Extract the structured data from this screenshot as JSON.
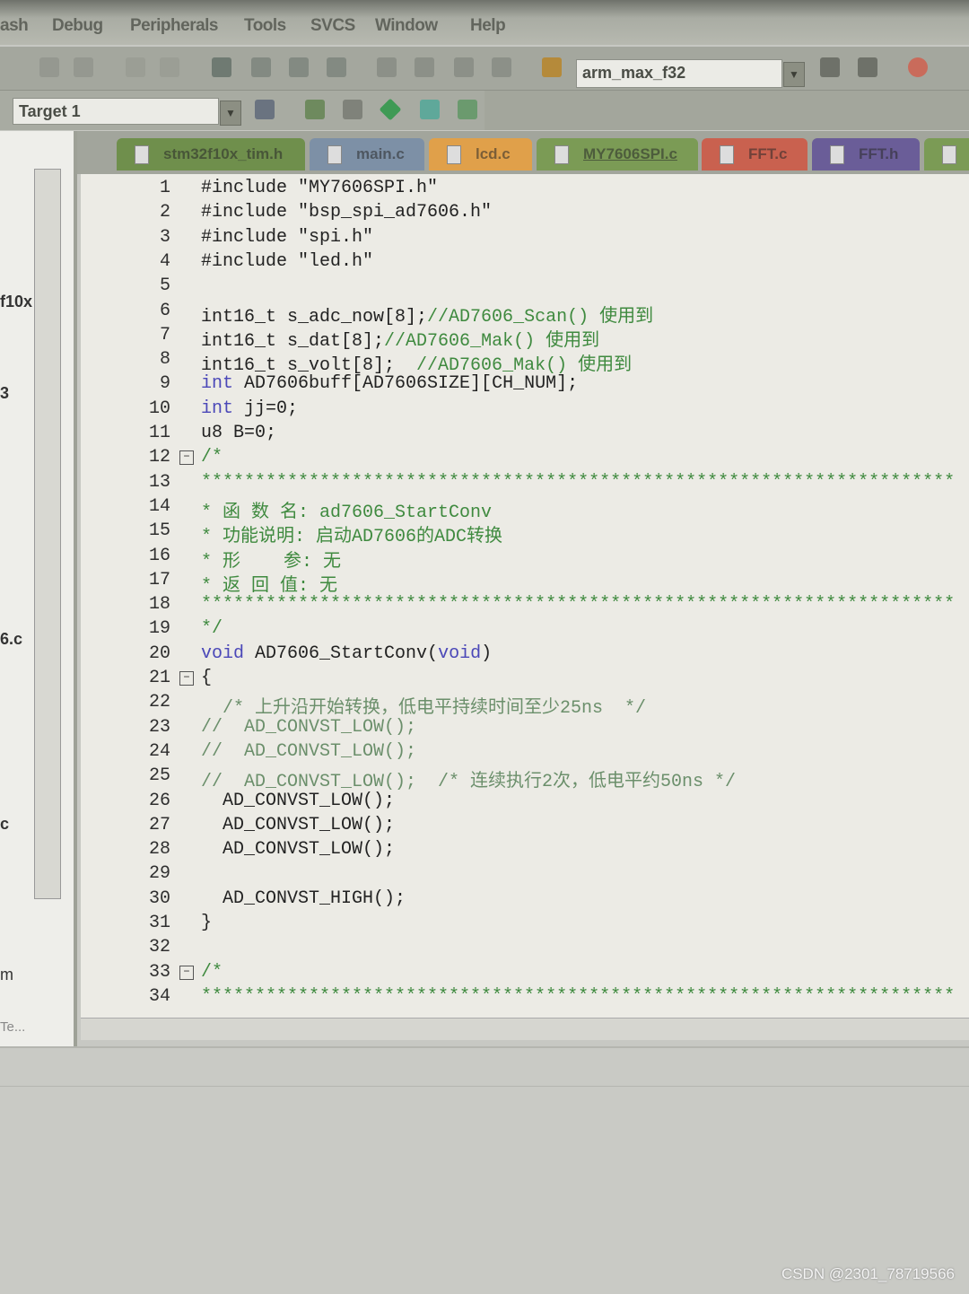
{
  "menu": [
    "ash",
    "Debug",
    "Peripherals",
    "Tools",
    "SVCS",
    "Window",
    "Help"
  ],
  "toolbar": {
    "find_combo_value": "arm_max_f32",
    "target_combo_value": "Target 1"
  },
  "tabs": [
    {
      "label": "stm32f10x_tim.h",
      "color": "#6f8f4c"
    },
    {
      "label": "main.c",
      "color": "#7d90a6"
    },
    {
      "label": "lcd.c",
      "color": "#e0a04a"
    },
    {
      "label": "MY7606SPI.c",
      "color": "#7b9b55",
      "active": true
    },
    {
      "label": "FFT.c",
      "color": "#c9614f"
    },
    {
      "label": "FFT.h",
      "color": "#6a5d98"
    },
    {
      "label": "",
      "color": "#7b9b55"
    }
  ],
  "left_panel": {
    "fragments": [
      "f10x",
      "3",
      "6.c",
      "c",
      "m",
      "Te..."
    ]
  },
  "code_lines": [
    {
      "n": "1",
      "t": [
        [
          "n",
          "#include \"MY7606SPI.h\""
        ]
      ]
    },
    {
      "n": "2",
      "t": [
        [
          "n",
          "#include \"bsp_spi_ad7606.h\""
        ]
      ]
    },
    {
      "n": "3",
      "t": [
        [
          "n",
          "#include \"spi.h\""
        ]
      ]
    },
    {
      "n": "4",
      "t": [
        [
          "n",
          "#include \"led.h\""
        ]
      ]
    },
    {
      "n": "5",
      "t": []
    },
    {
      "n": "6",
      "t": [
        [
          "n",
          "int16_t s_adc_now[8];"
        ],
        [
          "c",
          "//AD7606_Scan() 使用到"
        ]
      ]
    },
    {
      "n": "7",
      "t": [
        [
          "n",
          "int16_t s_dat[8];"
        ],
        [
          "c",
          "//AD7606_Mak() 使用到"
        ]
      ]
    },
    {
      "n": "8",
      "t": [
        [
          "n",
          "int16_t s_volt[8];  "
        ],
        [
          "c",
          "//AD7606_Mak() 使用到"
        ]
      ]
    },
    {
      "n": "9",
      "t": [
        [
          "k",
          "int"
        ],
        [
          "n",
          " AD7606buff[AD7606SIZE][CH_NUM];"
        ]
      ]
    },
    {
      "n": "10",
      "t": [
        [
          "k",
          "int"
        ],
        [
          "n",
          " jj=0;"
        ]
      ]
    },
    {
      "n": "11",
      "t": [
        [
          "n",
          "u8 B=0;"
        ]
      ]
    },
    {
      "n": "12",
      "fold": "−",
      "t": [
        [
          "c",
          "/*"
        ]
      ]
    },
    {
      "n": "13",
      "t": [
        [
          "c",
          "**********************************************************************"
        ]
      ]
    },
    {
      "n": "14",
      "t": [
        [
          "c",
          "* 函 数 名: ad7606_StartConv"
        ]
      ]
    },
    {
      "n": "15",
      "t": [
        [
          "c",
          "* 功能说明: 启动AD7606的ADC转换"
        ]
      ]
    },
    {
      "n": "16",
      "t": [
        [
          "c",
          "* 形    参: 无"
        ]
      ]
    },
    {
      "n": "17",
      "t": [
        [
          "c",
          "* 返 回 值: 无"
        ]
      ]
    },
    {
      "n": "18",
      "t": [
        [
          "c",
          "**********************************************************************"
        ]
      ]
    },
    {
      "n": "19",
      "t": [
        [
          "c",
          "*/"
        ]
      ]
    },
    {
      "n": "20",
      "t": [
        [
          "k",
          "void"
        ],
        [
          "n",
          " AD7606_StartConv("
        ],
        [
          "k",
          "void"
        ],
        [
          "n",
          ")"
        ]
      ]
    },
    {
      "n": "21",
      "fold": "−",
      "t": [
        [
          "n",
          "{"
        ]
      ]
    },
    {
      "n": "22",
      "t": [
        [
          "g",
          "  /* 上升沿开始转换，低电平持续时间至少25ns  */"
        ]
      ]
    },
    {
      "n": "23",
      "t": [
        [
          "g",
          "//  AD_CONVST_LOW();"
        ]
      ]
    },
    {
      "n": "24",
      "t": [
        [
          "g",
          "//  AD_CONVST_LOW();"
        ]
      ]
    },
    {
      "n": "25",
      "t": [
        [
          "g",
          "//  AD_CONVST_LOW();  /* 连续执行2次，低电平约50ns */"
        ]
      ]
    },
    {
      "n": "26",
      "t": [
        [
          "n",
          "  AD_CONVST_LOW();"
        ]
      ]
    },
    {
      "n": "27",
      "t": [
        [
          "n",
          "  AD_CONVST_LOW();"
        ]
      ]
    },
    {
      "n": "28",
      "t": [
        [
          "n",
          "  AD_CONVST_LOW();"
        ]
      ]
    },
    {
      "n": "29",
      "t": []
    },
    {
      "n": "30",
      "t": [
        [
          "n",
          "  AD_CONVST_HIGH();"
        ]
      ]
    },
    {
      "n": "31",
      "t": [
        [
          "n",
          "}"
        ]
      ]
    },
    {
      "n": "32",
      "t": []
    },
    {
      "n": "33",
      "fold": "−",
      "t": [
        [
          "c",
          "/*"
        ]
      ]
    },
    {
      "n": "34",
      "t": [
        [
          "c",
          "**********************************************************************"
        ]
      ]
    }
  ],
  "watermark": "CSDN @2301_78719566"
}
